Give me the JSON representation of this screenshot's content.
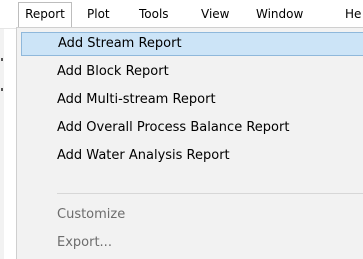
{
  "menubar": {
    "items": [
      {
        "label": "Report"
      },
      {
        "label": "Plot"
      },
      {
        "label": "Tools"
      },
      {
        "label": "View"
      },
      {
        "label": "Window"
      },
      {
        "label": "He"
      }
    ]
  },
  "report_menu": {
    "items": [
      {
        "label": "Add Stream Report",
        "state": "highlighted"
      },
      {
        "label": "Add Block Report",
        "state": "enabled"
      },
      {
        "label": "Add Multi-stream Report",
        "state": "enabled"
      },
      {
        "label": "Add Overall Process Balance Report",
        "state": "enabled"
      },
      {
        "label": "Add Water Analysis Report",
        "state": "enabled"
      },
      {
        "label": "Customize",
        "state": "disabled"
      },
      {
        "label": "Export...",
        "state": "disabled"
      }
    ]
  },
  "colors": {
    "menu_background": "#f2f2f2",
    "highlight_fill": "#cce4f7",
    "highlight_border": "#8fb8db",
    "disabled_text": "#6d6d6d"
  }
}
